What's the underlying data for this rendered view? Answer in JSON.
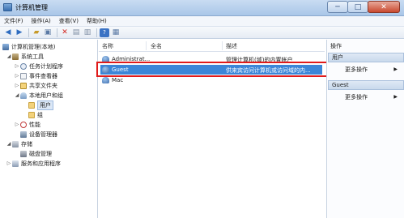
{
  "window": {
    "title": "计算机管理",
    "minimize": "─",
    "maximize": "□",
    "close": "✕"
  },
  "menu": [
    "文件(F)",
    "操作(A)",
    "查看(V)",
    "帮助(H)"
  ],
  "toolbar": [
    "back-icon",
    "forward-icon",
    "up-folder-icon",
    "show-tree-icon",
    "delete-icon",
    "properties-icon",
    "export-icon",
    "help-icon",
    "view-icon"
  ],
  "tree": {
    "root": "计算机管理(本地)",
    "system_tools": "系统工具",
    "task_scheduler": "任务计划程序",
    "event_viewer": "事件查看器",
    "shared_folders": "共享文件夹",
    "local_users_groups": "本地用户和组",
    "users": "用户",
    "groups": "组",
    "performance": "性能",
    "device_manager": "设备管理器",
    "storage": "存储",
    "disk_management": "磁盘管理",
    "services_apps": "服务和应用程序"
  },
  "list": {
    "columns": [
      "名称",
      "全名",
      "描述"
    ],
    "rows": [
      {
        "name": "Administrat...",
        "fullname": "",
        "desc": "管理计算机(域)的内置帐户"
      },
      {
        "name": "Guest",
        "fullname": "",
        "desc": "供来宾访问计算机或访问域的内..."
      },
      {
        "name": "Mac",
        "fullname": "",
        "desc": ""
      }
    ]
  },
  "actions": {
    "title": "操作",
    "section1": "用户",
    "more1": "更多操作",
    "section2": "Guest",
    "more2": "更多操作"
  },
  "colors": {
    "selection": "#3b86d8",
    "highlight_box": "#e01b1b"
  }
}
